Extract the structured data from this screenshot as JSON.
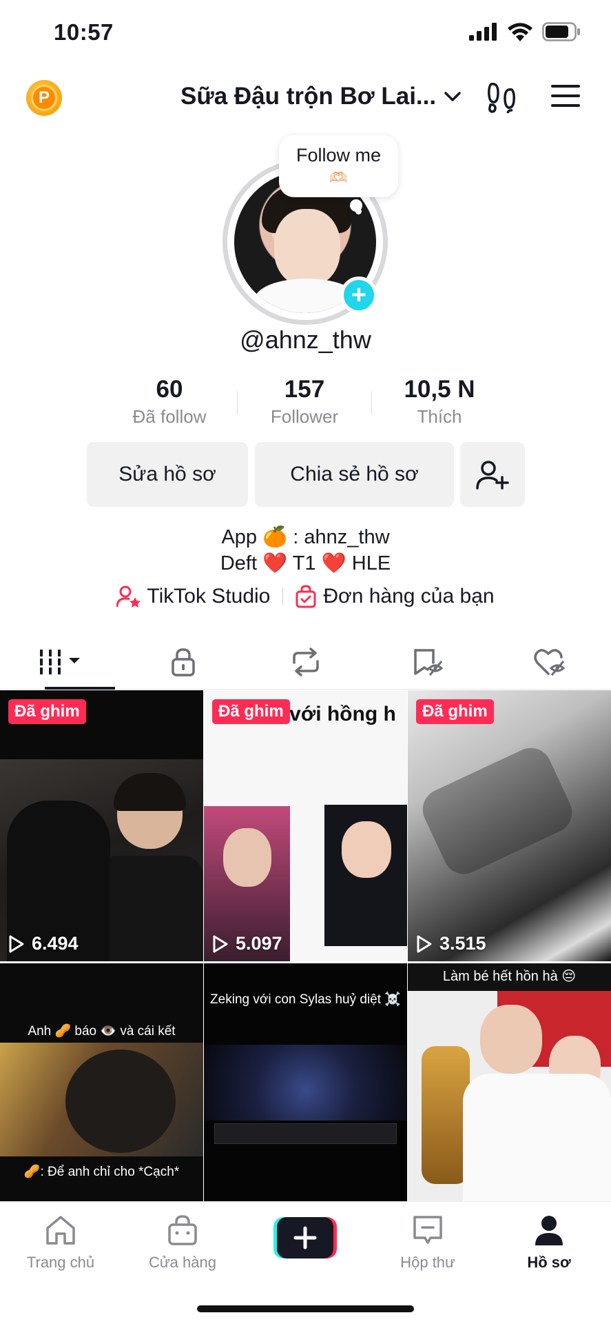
{
  "status_bar": {
    "time": "10:57"
  },
  "header": {
    "title": "Sữa Đậu trộn Bơ Lai...",
    "coin_letter": "P"
  },
  "profile": {
    "bubble_text": "Follow me",
    "bubble_emoji": "🫶🏻",
    "username": "@ahnz_thw",
    "stats": [
      {
        "value": "60",
        "label": "Đã follow"
      },
      {
        "value": "157",
        "label": "Follower"
      },
      {
        "value": "10,5 N",
        "label": "Thích"
      }
    ],
    "buttons": {
      "edit": "Sửa hồ sơ",
      "share": "Chia sẻ hồ sơ"
    },
    "bio_line1": "App 🍊 : ahnz_thw",
    "bio_line2": "Deft ❤️ T1 ❤️ HLE",
    "links": {
      "studio": "TikTok Studio",
      "orders": "Đơn hàng của bạn"
    }
  },
  "tabs": [
    {
      "icon": "grid-icon",
      "active": true
    },
    {
      "icon": "lock-icon"
    },
    {
      "icon": "repost-icon"
    },
    {
      "icon": "bookmark-icon"
    },
    {
      "icon": "liked-heart-icon"
    }
  ],
  "videos": [
    {
      "pinned_label": "Đã ghim",
      "views": "6.494"
    },
    {
      "pinned_label": "Đã ghim",
      "views": "5.097",
      "caption": "đi chơi với hồng h"
    },
    {
      "pinned_label": "Đã ghim",
      "views": "3.515"
    },
    {
      "caption_top": "Anh 🥜 báo 👁️ và cái kết",
      "caption_bottom": "🥜: Để anh chỉ cho *Cạch*"
    },
    {
      "caption_top": "Zeking với con Sylas huỷ diệt ☠️"
    },
    {
      "caption_top": "Làm bé hết hồn hà 😔"
    }
  ],
  "bottom_nav": [
    {
      "label": "Trang chủ",
      "icon": "home-icon"
    },
    {
      "label": "Cửa hàng",
      "icon": "shop-icon"
    },
    {
      "label": "",
      "icon": "create-plus-icon"
    },
    {
      "label": "Hộp thư",
      "icon": "inbox-icon"
    },
    {
      "label": "Hồ sơ",
      "icon": "profile-icon",
      "active": true
    }
  ],
  "colors": {
    "accent_red": "#fe2c55",
    "accent_cyan": "#20d5ec",
    "text": "#161823",
    "muted": "#8a8b91"
  }
}
